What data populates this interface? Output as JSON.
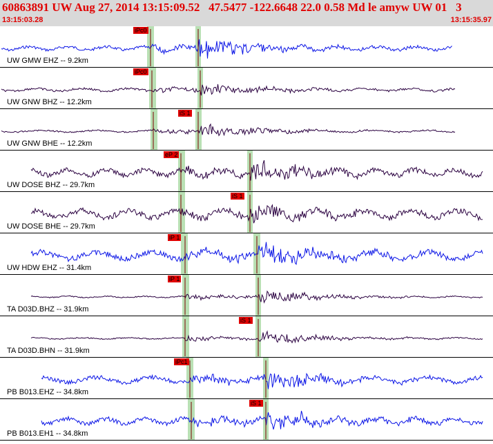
{
  "header": {
    "title": "60863891 UW Aug 27, 2014 13:15:09.52   47.5477 -122.6648 22.0 0.58 Md le amyw UW 01   3",
    "start_time": "13:15:03.28",
    "end_time": "13:15:35.97"
  },
  "colors": {
    "header_bg": "#d9d9d9",
    "title": "#e00000",
    "trace_blue": "#0a14e6",
    "trace_dark": "#2a0040",
    "pick": "#e00000",
    "shade": "#b9e0b4"
  },
  "channels": [
    {
      "label": "UW GMW EHZ -- 9.2km",
      "color": "blue",
      "pick": "iPc0",
      "s_pick": ""
    },
    {
      "label": "UW GNW BHZ -- 12.2km",
      "color": "dark",
      "pick": "iPc0",
      "s_pick": ""
    },
    {
      "label": "UW GNW BHE -- 12.2km",
      "color": "dark",
      "pick": "",
      "s_pick": "iS 1"
    },
    {
      "label": "UW DOSE BHZ -- 29.7km",
      "color": "dark",
      "pick": "eP 2",
      "s_pick": ""
    },
    {
      "label": "UW DOSE BHE -- 29.7km",
      "color": "dark",
      "pick": "",
      "s_pick": "iS 1"
    },
    {
      "label": "UW HDW EHZ -- 31.4km",
      "color": "blue",
      "pick": "iP 1",
      "s_pick": ""
    },
    {
      "label": "TA D03D.BHZ -- 31.9km",
      "color": "dark",
      "pick": "iP 1",
      "s_pick": ""
    },
    {
      "label": "TA D03D.BHN -- 31.9km",
      "color": "dark",
      "pick": "",
      "s_pick": "iS 1"
    },
    {
      "label": "PB B013.EHZ -- 34.8km",
      "color": "blue",
      "pick": "iPc1",
      "s_pick": ""
    },
    {
      "label": "PB B013.EH1 -- 34.8km",
      "color": "blue",
      "pick": "",
      "s_pick": "iS 1"
    }
  ]
}
